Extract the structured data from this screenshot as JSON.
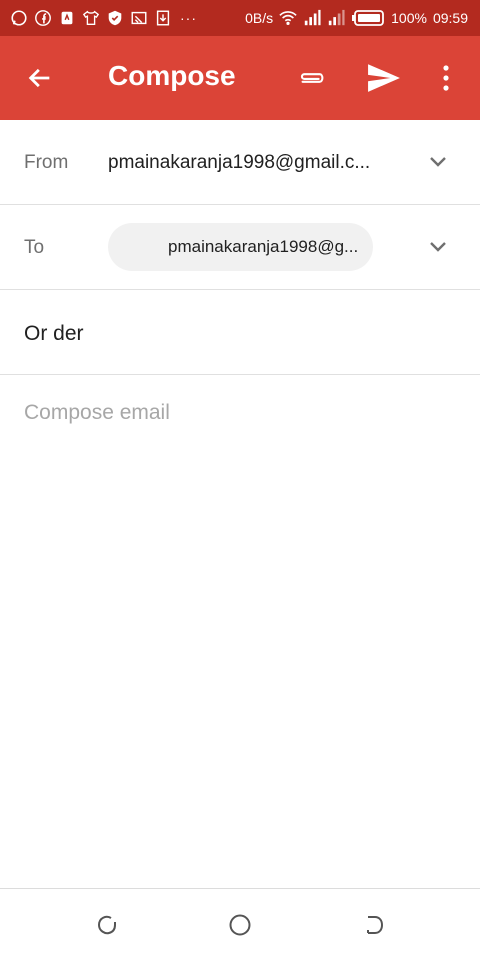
{
  "status_bar": {
    "net_speed": "0B/s",
    "battery": "100%",
    "time": "09:59",
    "more": "···"
  },
  "app_bar": {
    "title": "Compose",
    "color": "#db4437"
  },
  "from": {
    "label": "From",
    "value": "pmainakaranja1998@gmail.c..."
  },
  "to": {
    "label": "To",
    "recipient": "pmainakaranja1998@g..."
  },
  "subject": {
    "value": "Or der"
  },
  "body": {
    "placeholder": "Compose email"
  }
}
